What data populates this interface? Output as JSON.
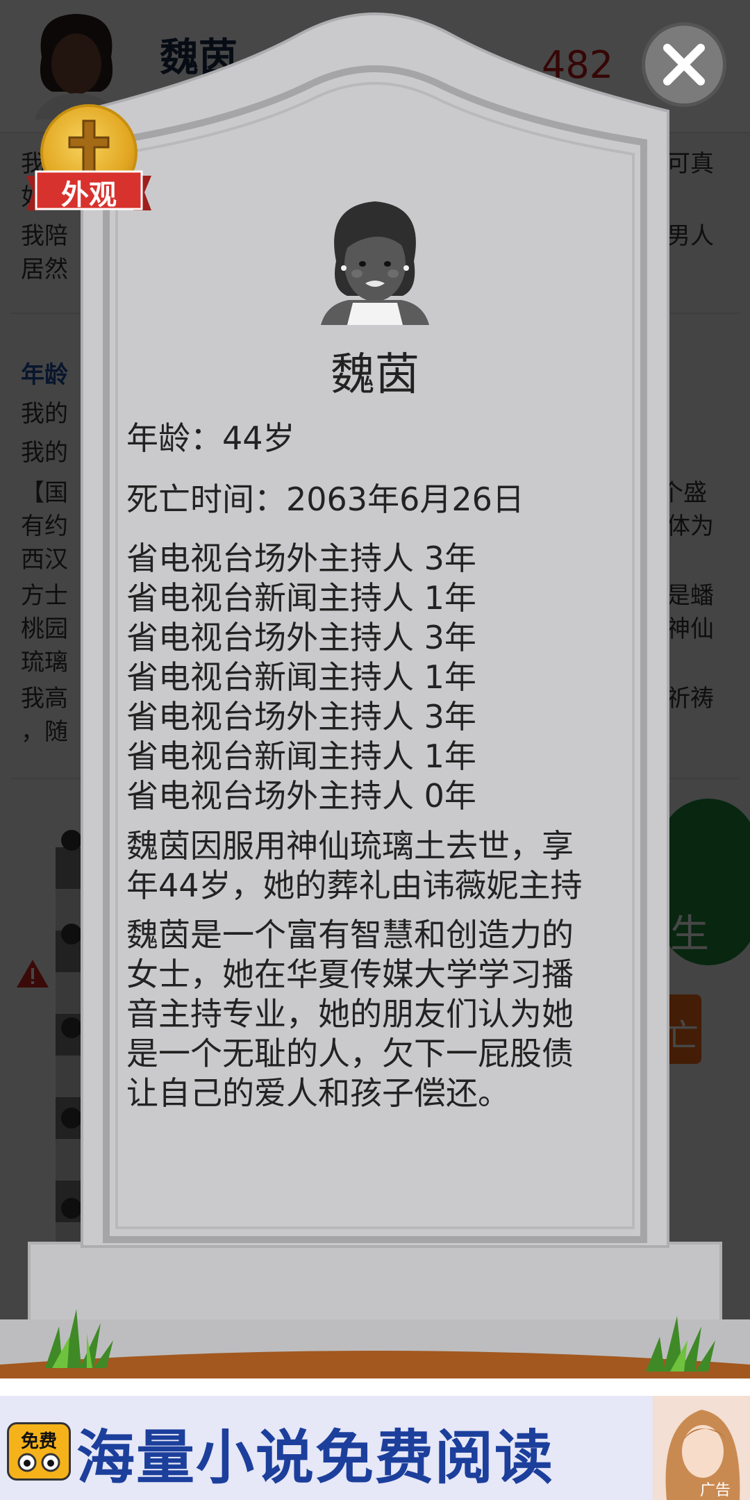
{
  "background": {
    "profile_name": "魏茵",
    "money": "482",
    "lines": [
      "我",
      "可真",
      "如",
      "我陪",
      "男人",
      "居然",
      "年龄",
      "我的",
      "我的",
      "【国",
      "个盛",
      "有约",
      "体为",
      "西汉",
      "方士",
      "是蟠",
      "桃园",
      "神仙",
      "琉璃",
      "我高",
      "祈祷",
      "，随"
    ],
    "green_button_label": "生",
    "orange_button_label": "亡"
  },
  "badge": {
    "label": "外观",
    "icon": "cross-icon"
  },
  "tombstone": {
    "name": "魏茵",
    "age": "年龄：44岁",
    "death_time": "死亡时间：2063年6月26日",
    "career": [
      "省电视台场外主持人 3年",
      "省电视台新闻主持人 1年",
      "省电视台场外主持人 3年",
      "省电视台新闻主持人 1年",
      "省电视台场外主持人 3年",
      "省电视台新闻主持人 1年",
      "省电视台场外主持人 0年"
    ],
    "death_line1": "魏茵因服用神仙琉璃土去世，享",
    "death_line2": "年44岁，她的葬礼由讳薇妮主持",
    "bio_lines": [
      "魏茵是一个富有智慧和创造力的",
      "女士，她在华夏传媒大学学习播",
      "音主持专业，她的朋友们认为她",
      "是一个无耻的人，欠下一屁股债",
      "让自己的爱人和孩子偿还。"
    ]
  },
  "close_icon": "close-icon",
  "ad": {
    "icon_label": "免费",
    "headline": "海量小说免费阅读",
    "tag": "广告"
  },
  "colors": {
    "stone": "#c9c9cb",
    "stone_edge": "#9c9ca0",
    "dirt": "#a2581f",
    "grass": "#3f8a27",
    "ribbon": "#d8322e",
    "ad_text": "#1c3f9c"
  }
}
